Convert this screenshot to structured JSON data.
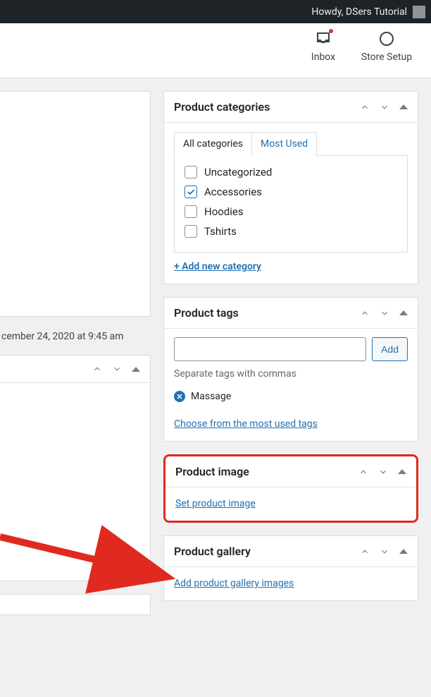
{
  "adminbar": {
    "greeting": "Howdy, DSers Tutorial"
  },
  "topbar": {
    "inbox_label": "Inbox",
    "store_setup_label": "Store Setup"
  },
  "revision": {
    "text": "cember 24, 2020 at 9:45 am"
  },
  "categories": {
    "title": "Product categories",
    "tabs": {
      "all": "All categories",
      "most": "Most Used"
    },
    "items": [
      {
        "label": "Uncategorized",
        "checked": false
      },
      {
        "label": "Accessories",
        "checked": true
      },
      {
        "label": "Hoodies",
        "checked": false
      },
      {
        "label": "Tshirts",
        "checked": false
      }
    ],
    "add_new": "+ Add new category"
  },
  "tags": {
    "title": "Product tags",
    "add_btn": "Add",
    "hint": "Separate tags with commas",
    "existing": [
      "Massage"
    ],
    "choose_link": "Choose from the most used tags"
  },
  "product_image": {
    "title": "Product image",
    "set_link": "Set product image"
  },
  "gallery": {
    "title": "Product gallery",
    "add_link": "Add product gallery images"
  }
}
